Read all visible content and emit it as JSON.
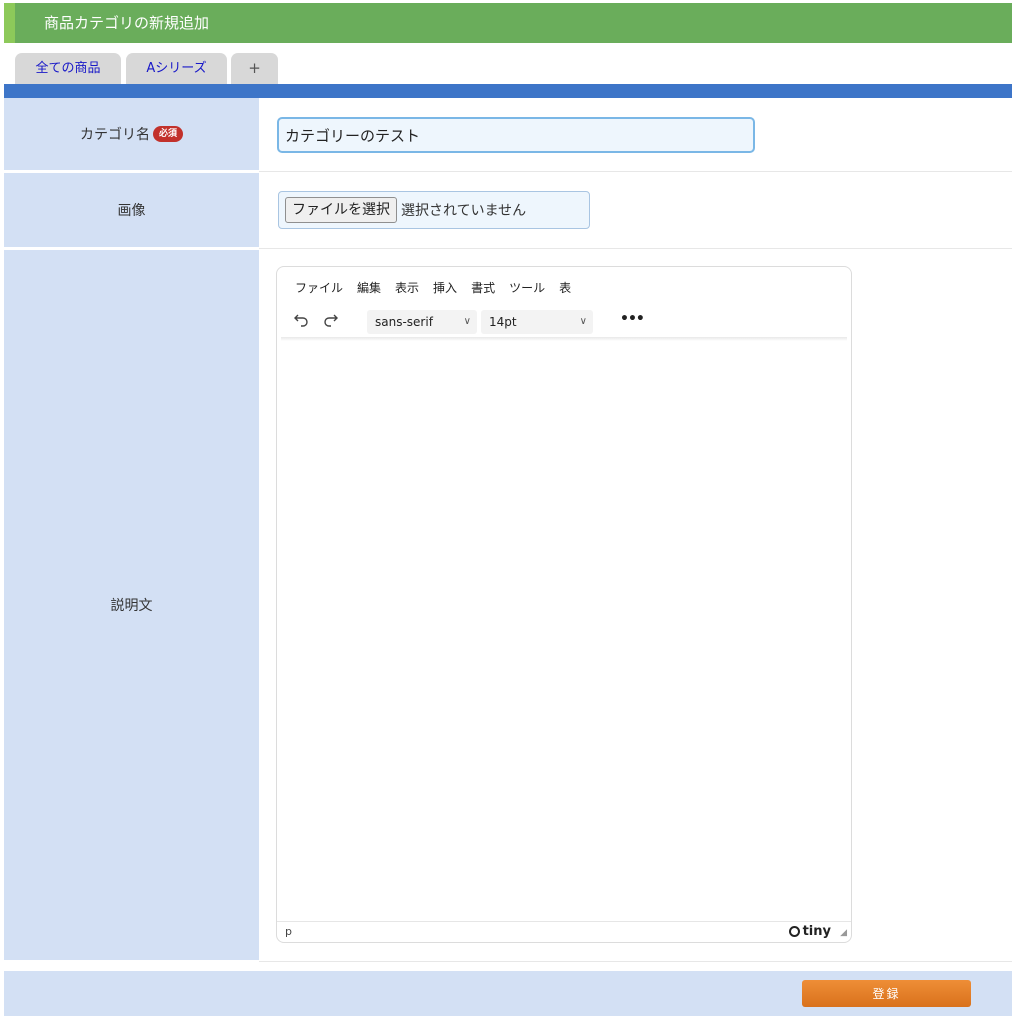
{
  "header": {
    "title": "商品カテゴリの新規追加"
  },
  "tabs": [
    {
      "label": "全ての商品"
    },
    {
      "label": "Aシリーズ"
    },
    {
      "label": "+"
    }
  ],
  "form": {
    "category_name": {
      "label": "カテゴリ名",
      "required_badge": "必須",
      "value": "カテゴリーのテスト"
    },
    "image": {
      "label": "画像",
      "button_label": "ファイルを選択",
      "status": "選択されていません"
    },
    "description": {
      "label": "説明文"
    }
  },
  "editor": {
    "menu": [
      "ファイル",
      "編集",
      "表示",
      "挿入",
      "書式",
      "ツール",
      "表"
    ],
    "font_family": "sans-serif",
    "font_size": "14pt",
    "status_path": "p",
    "brand": "tiny",
    "icons": [
      "undo-icon",
      "redo-icon",
      "chevron-down-icon",
      "more-icon",
      "resize-icon"
    ]
  },
  "footer": {
    "submit_label": "登録"
  },
  "colors": {
    "header": "#6aad5b",
    "tab_bar": "#3d75c8",
    "label_bg": "#d3e0f4",
    "required": "#c2312b",
    "submit": "#e07f28"
  }
}
